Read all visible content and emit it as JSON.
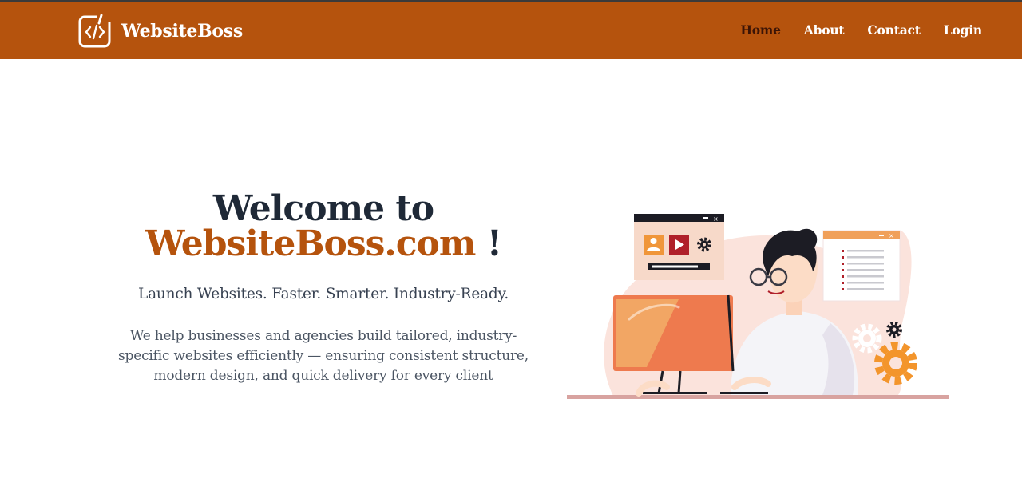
{
  "brand": {
    "name": "WebsiteBoss",
    "icon": "code-window-icon",
    "color": "#b5530d"
  },
  "nav": {
    "items": [
      {
        "label": "Home",
        "active": true
      },
      {
        "label": "About",
        "active": false
      },
      {
        "label": "Contact",
        "active": false
      },
      {
        "label": "Login",
        "active": false
      }
    ]
  },
  "hero": {
    "title_line1": "Welcome to",
    "title_brand": "WebsiteBoss.com",
    "title_suffix": " !",
    "tagline": "Launch Websites. Faster. Smarter. Industry-Ready.",
    "description": "We help businesses and agencies build tailored, industry-specific websites efficiently — ensuring consistent structure, modern design, and quick delivery for every client"
  },
  "illustration": {
    "subject": "developer-at-computer-illustration"
  }
}
